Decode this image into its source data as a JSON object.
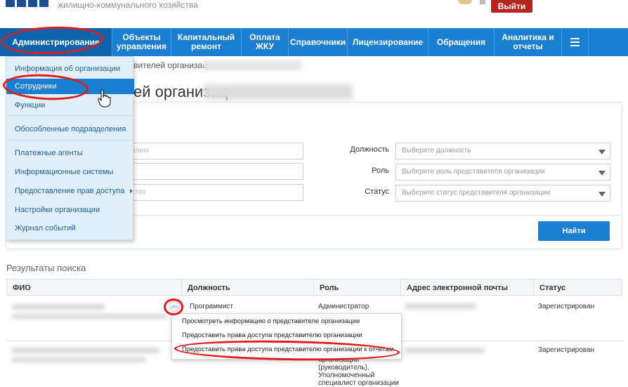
{
  "header": {
    "org_subtitle": "жилищно-коммунального хозяйства",
    "logout_label": "Выйти"
  },
  "nav": {
    "items": [
      {
        "label": "Администрирование"
      },
      {
        "label": "Объекты управления"
      },
      {
        "label": "Капитальный ремонт"
      },
      {
        "label": "Оплата ЖКУ"
      },
      {
        "label": "Справочники"
      },
      {
        "label": "Лицензирование"
      },
      {
        "label": "Обращения"
      },
      {
        "label": "Аналитика и отчеты"
      }
    ]
  },
  "admin_menu": {
    "items": [
      {
        "label": "Информация об организации"
      },
      {
        "label": "Сотрудники"
      },
      {
        "label": "Функции"
      },
      {
        "label": "Обособленные подразделения"
      },
      {
        "label": "Платежные агенты"
      },
      {
        "label": "Информационные системы"
      },
      {
        "label": "Предоставление прав доступа"
      },
      {
        "label": "Настройки организации"
      },
      {
        "label": "Журнал событий"
      }
    ]
  },
  "page": {
    "breadcrumb": "вителей организац",
    "title": "ей организац"
  },
  "filters": {
    "fields": [
      {
        "placeholder": "илию"
      },
      {
        "placeholder": ""
      },
      {
        "placeholder": "ство"
      }
    ],
    "position_label": "Должность",
    "position_placeholder": "Выберите должность",
    "role_label": "Роль",
    "role_placeholder": "Выберите роль представителя организации",
    "status_label": "Статус",
    "status_placeholder": "Выберите статус представителя организации",
    "find_label": "Найти"
  },
  "results": {
    "title": "Результаты поиска",
    "columns": [
      "ФИО",
      "Должность",
      "Роль",
      "Адрес электронной почты",
      "Статус"
    ],
    "rows": [
      {
        "position": "Программист",
        "role": "Администратор",
        "status": "Зарегистрирован"
      },
      {
        "position": "",
        "role": "организации (руководитель), Уполномоченный специалист организации",
        "status": "Зарегистрирован"
      }
    ]
  },
  "context_menu": {
    "items": [
      {
        "label": "Просмотреть информацию о представителе организации"
      },
      {
        "label": "Предоставить права доступа представителю организации"
      },
      {
        "label": "Предоставить права доступа представителю организации к отчетам"
      }
    ]
  },
  "colors": {
    "nav_bg": "#1a7fd0",
    "logout_bg": "#b8231d",
    "annotation": "#e41b1b",
    "menu_bg": "#e0effa"
  }
}
